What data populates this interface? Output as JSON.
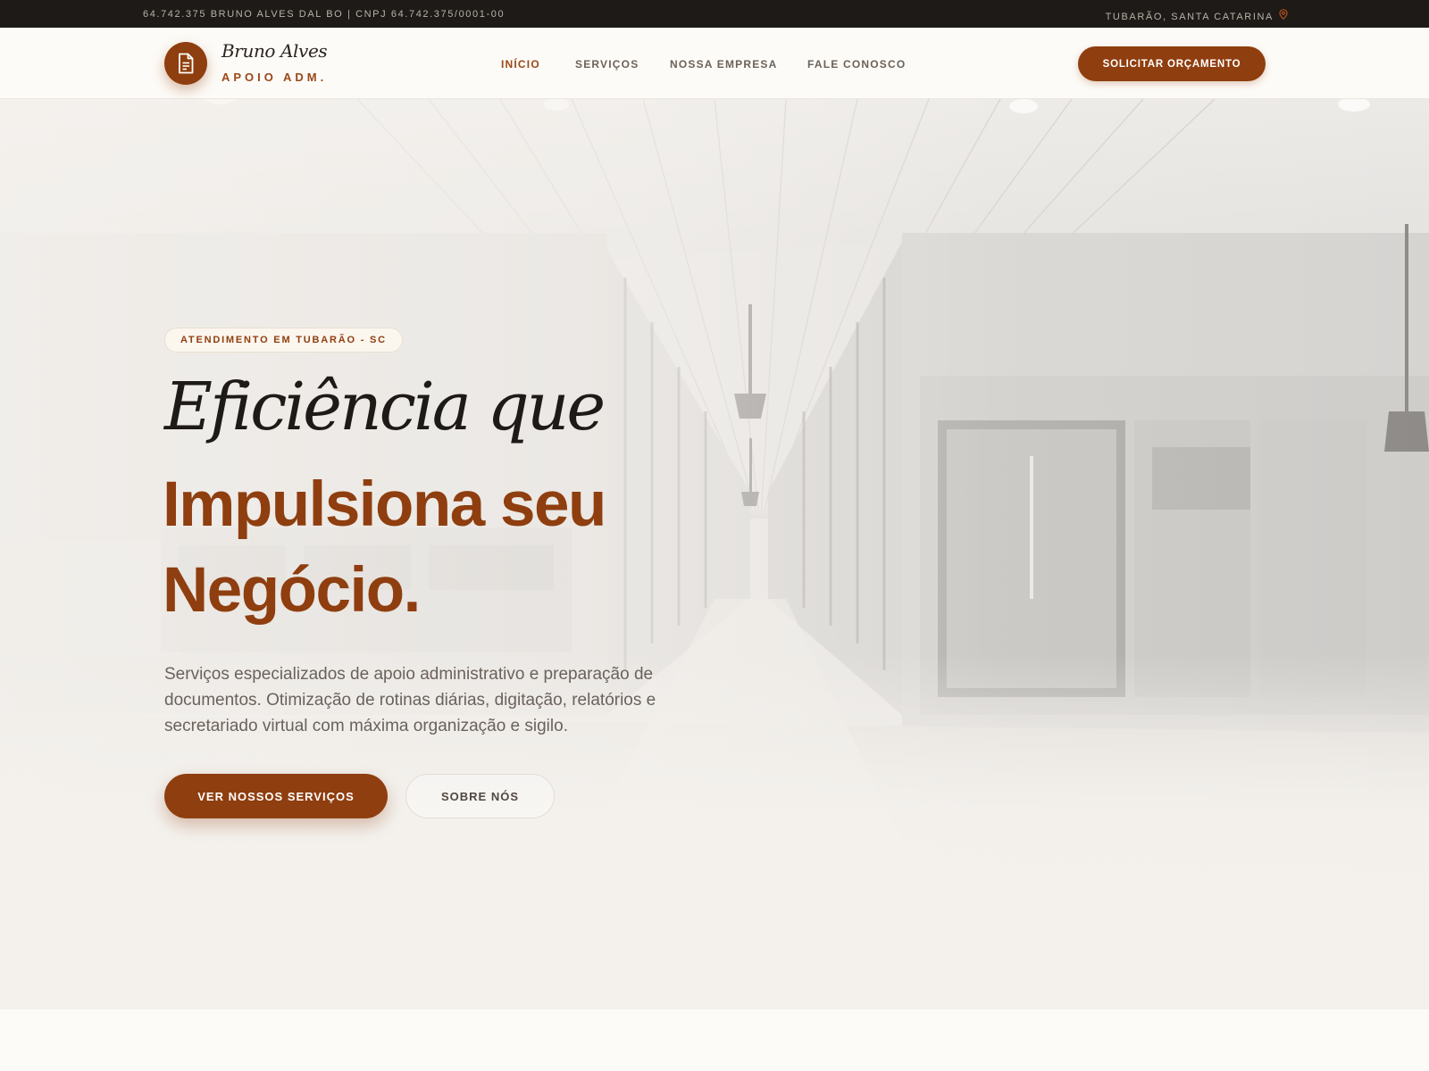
{
  "topbar": {
    "company_info": "64.742.375 BRUNO ALVES DAL BO | CNPJ 64.742.375/0001-00",
    "location": "TUBARÃO, SANTA CATARINA"
  },
  "header": {
    "brand_name": "Bruno Alves",
    "brand_sub": "APOIO ADM.",
    "nav": [
      {
        "label": "INÍCIO",
        "active": true
      },
      {
        "label": "SERVIÇOS",
        "active": false
      },
      {
        "label": "NOSSA EMPRESA",
        "active": false
      },
      {
        "label": "FALE CONOSCO",
        "active": false
      }
    ],
    "cta_label": "SOLICITAR ORÇAMENTO"
  },
  "hero": {
    "badge": "ATENDIMENTO EM TUBARÃO - SC",
    "title_line1": "Eficiência que",
    "title_line2": "Impulsiona seu",
    "title_line3": "Negócio.",
    "lead": "Serviços especializados de apoio administrativo e preparação de documentos. Otimização de rotinas diárias, digitação, relatórios e secretariado virtual com máxima organização e sigilo.",
    "primary_button": "VER NOSSOS SERVIÇOS",
    "secondary_button": "SOBRE NÓS"
  },
  "colors": {
    "accent": "#8f3e0f",
    "topbar_bg": "#1d1a17",
    "page_bg": "#fdfbf7"
  },
  "icons": {
    "logo": "document-icon",
    "location": "map-pin-icon"
  }
}
